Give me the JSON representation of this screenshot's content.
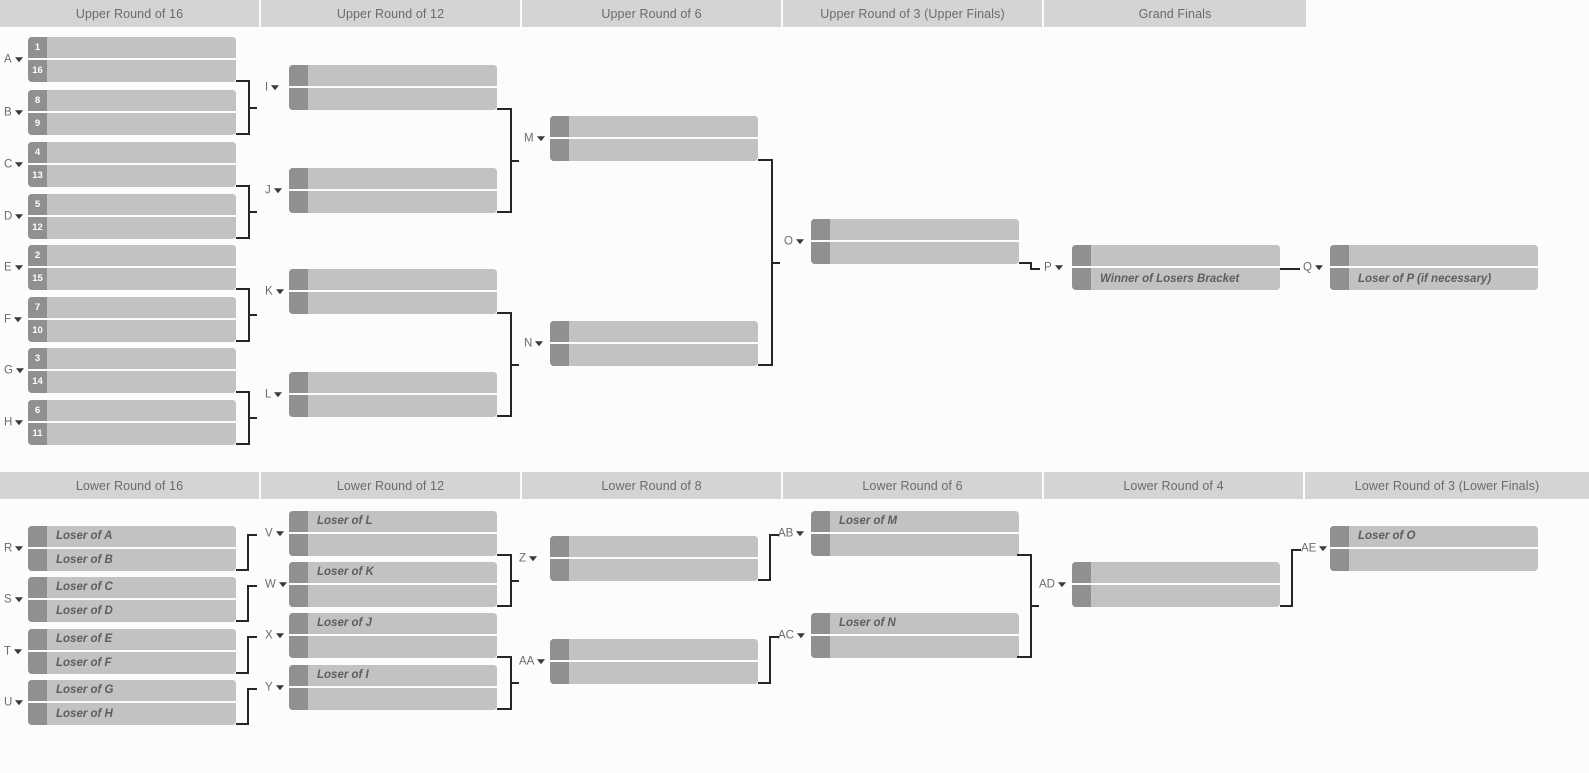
{
  "colors": {
    "background": "#fcfcfc",
    "header_bg": "#d4d4d4",
    "header_text": "#6b6b6b",
    "match_bg": "#c2c2c2",
    "seed_bg": "#909090",
    "seed_text": "#ffffff",
    "connector": "#262626",
    "label_text": "#6b6b6b",
    "entry_text": "#5e5e5e"
  },
  "upper": {
    "headers": [
      {
        "label": "Upper Round of 16"
      },
      {
        "label": "Upper Round of 12"
      },
      {
        "label": "Upper Round of 6"
      },
      {
        "label": "Upper Round of 3 (Upper Finals)"
      },
      {
        "label": "Grand Finals"
      }
    ],
    "matches": [
      {
        "id": "A",
        "label": "A",
        "seeds": [
          "1",
          "16"
        ],
        "names": [
          "",
          ""
        ]
      },
      {
        "id": "B",
        "label": "B",
        "seeds": [
          "8",
          "9"
        ],
        "names": [
          "",
          ""
        ]
      },
      {
        "id": "C",
        "label": "C",
        "seeds": [
          "4",
          "13"
        ],
        "names": [
          "",
          ""
        ]
      },
      {
        "id": "D",
        "label": "D",
        "seeds": [
          "5",
          "12"
        ],
        "names": [
          "",
          ""
        ]
      },
      {
        "id": "E",
        "label": "E",
        "seeds": [
          "2",
          "15"
        ],
        "names": [
          "",
          ""
        ]
      },
      {
        "id": "F",
        "label": "F",
        "seeds": [
          "7",
          "10"
        ],
        "names": [
          "",
          ""
        ]
      },
      {
        "id": "G",
        "label": "G",
        "seeds": [
          "3",
          "14"
        ],
        "names": [
          "",
          ""
        ]
      },
      {
        "id": "H",
        "label": "H",
        "seeds": [
          "6",
          "11"
        ],
        "names": [
          "",
          ""
        ]
      },
      {
        "id": "I",
        "label": "I",
        "seeds": [
          "",
          ""
        ],
        "names": [
          "",
          ""
        ]
      },
      {
        "id": "J",
        "label": "J",
        "seeds": [
          "",
          ""
        ],
        "names": [
          "",
          ""
        ]
      },
      {
        "id": "K",
        "label": "K",
        "seeds": [
          "",
          ""
        ],
        "names": [
          "",
          ""
        ]
      },
      {
        "id": "L",
        "label": "L",
        "seeds": [
          "",
          ""
        ],
        "names": [
          "",
          ""
        ]
      },
      {
        "id": "M",
        "label": "M",
        "seeds": [
          "",
          ""
        ],
        "names": [
          "",
          ""
        ]
      },
      {
        "id": "N",
        "label": "N",
        "seeds": [
          "",
          ""
        ],
        "names": [
          "",
          ""
        ]
      },
      {
        "id": "O",
        "label": "O",
        "seeds": [
          "",
          ""
        ],
        "names": [
          "",
          ""
        ]
      },
      {
        "id": "P",
        "label": "P",
        "seeds": [
          "",
          ""
        ],
        "names": [
          "",
          "Winner of Losers Bracket"
        ]
      },
      {
        "id": "Q",
        "label": "Q",
        "seeds": [
          "",
          ""
        ],
        "names": [
          "",
          "Loser of P (if necessary)"
        ]
      }
    ]
  },
  "lower": {
    "headers": [
      {
        "label": "Lower Round of 16"
      },
      {
        "label": "Lower Round of 12"
      },
      {
        "label": "Lower Round of 8"
      },
      {
        "label": "Lower Round of 6"
      },
      {
        "label": "Lower Round of 4"
      },
      {
        "label": "Lower Round of 3 (Lower Finals)"
      }
    ],
    "matches": [
      {
        "id": "R",
        "label": "R",
        "seeds": [
          "",
          ""
        ],
        "names": [
          "Loser of A",
          "Loser of B"
        ]
      },
      {
        "id": "S",
        "label": "S",
        "seeds": [
          "",
          ""
        ],
        "names": [
          "Loser of C",
          "Loser of D"
        ]
      },
      {
        "id": "T",
        "label": "T",
        "seeds": [
          "",
          ""
        ],
        "names": [
          "Loser of E",
          "Loser of F"
        ]
      },
      {
        "id": "U",
        "label": "U",
        "seeds": [
          "",
          ""
        ],
        "names": [
          "Loser of G",
          "Loser of H"
        ]
      },
      {
        "id": "V",
        "label": "V",
        "seeds": [
          "",
          ""
        ],
        "names": [
          "Loser of L",
          ""
        ]
      },
      {
        "id": "W",
        "label": "W",
        "seeds": [
          "",
          ""
        ],
        "names": [
          "Loser of K",
          ""
        ]
      },
      {
        "id": "X",
        "label": "X",
        "seeds": [
          "",
          ""
        ],
        "names": [
          "Loser of J",
          ""
        ]
      },
      {
        "id": "Y",
        "label": "Y",
        "seeds": [
          "",
          ""
        ],
        "names": [
          "Loser of I",
          ""
        ]
      },
      {
        "id": "Z",
        "label": "Z",
        "seeds": [
          "",
          ""
        ],
        "names": [
          "",
          ""
        ]
      },
      {
        "id": "AA",
        "label": "AA",
        "seeds": [
          "",
          ""
        ],
        "names": [
          "",
          ""
        ]
      },
      {
        "id": "AB",
        "label": "AB",
        "seeds": [
          "",
          ""
        ],
        "names": [
          "Loser of M",
          ""
        ]
      },
      {
        "id": "AC",
        "label": "AC",
        "seeds": [
          "",
          ""
        ],
        "names": [
          "Loser of N",
          ""
        ]
      },
      {
        "id": "AD",
        "label": "AD",
        "seeds": [
          "",
          ""
        ],
        "names": [
          "",
          ""
        ]
      },
      {
        "id": "AE",
        "label": "AE",
        "seeds": [
          "",
          ""
        ],
        "names": [
          "Loser of O",
          ""
        ]
      }
    ]
  }
}
